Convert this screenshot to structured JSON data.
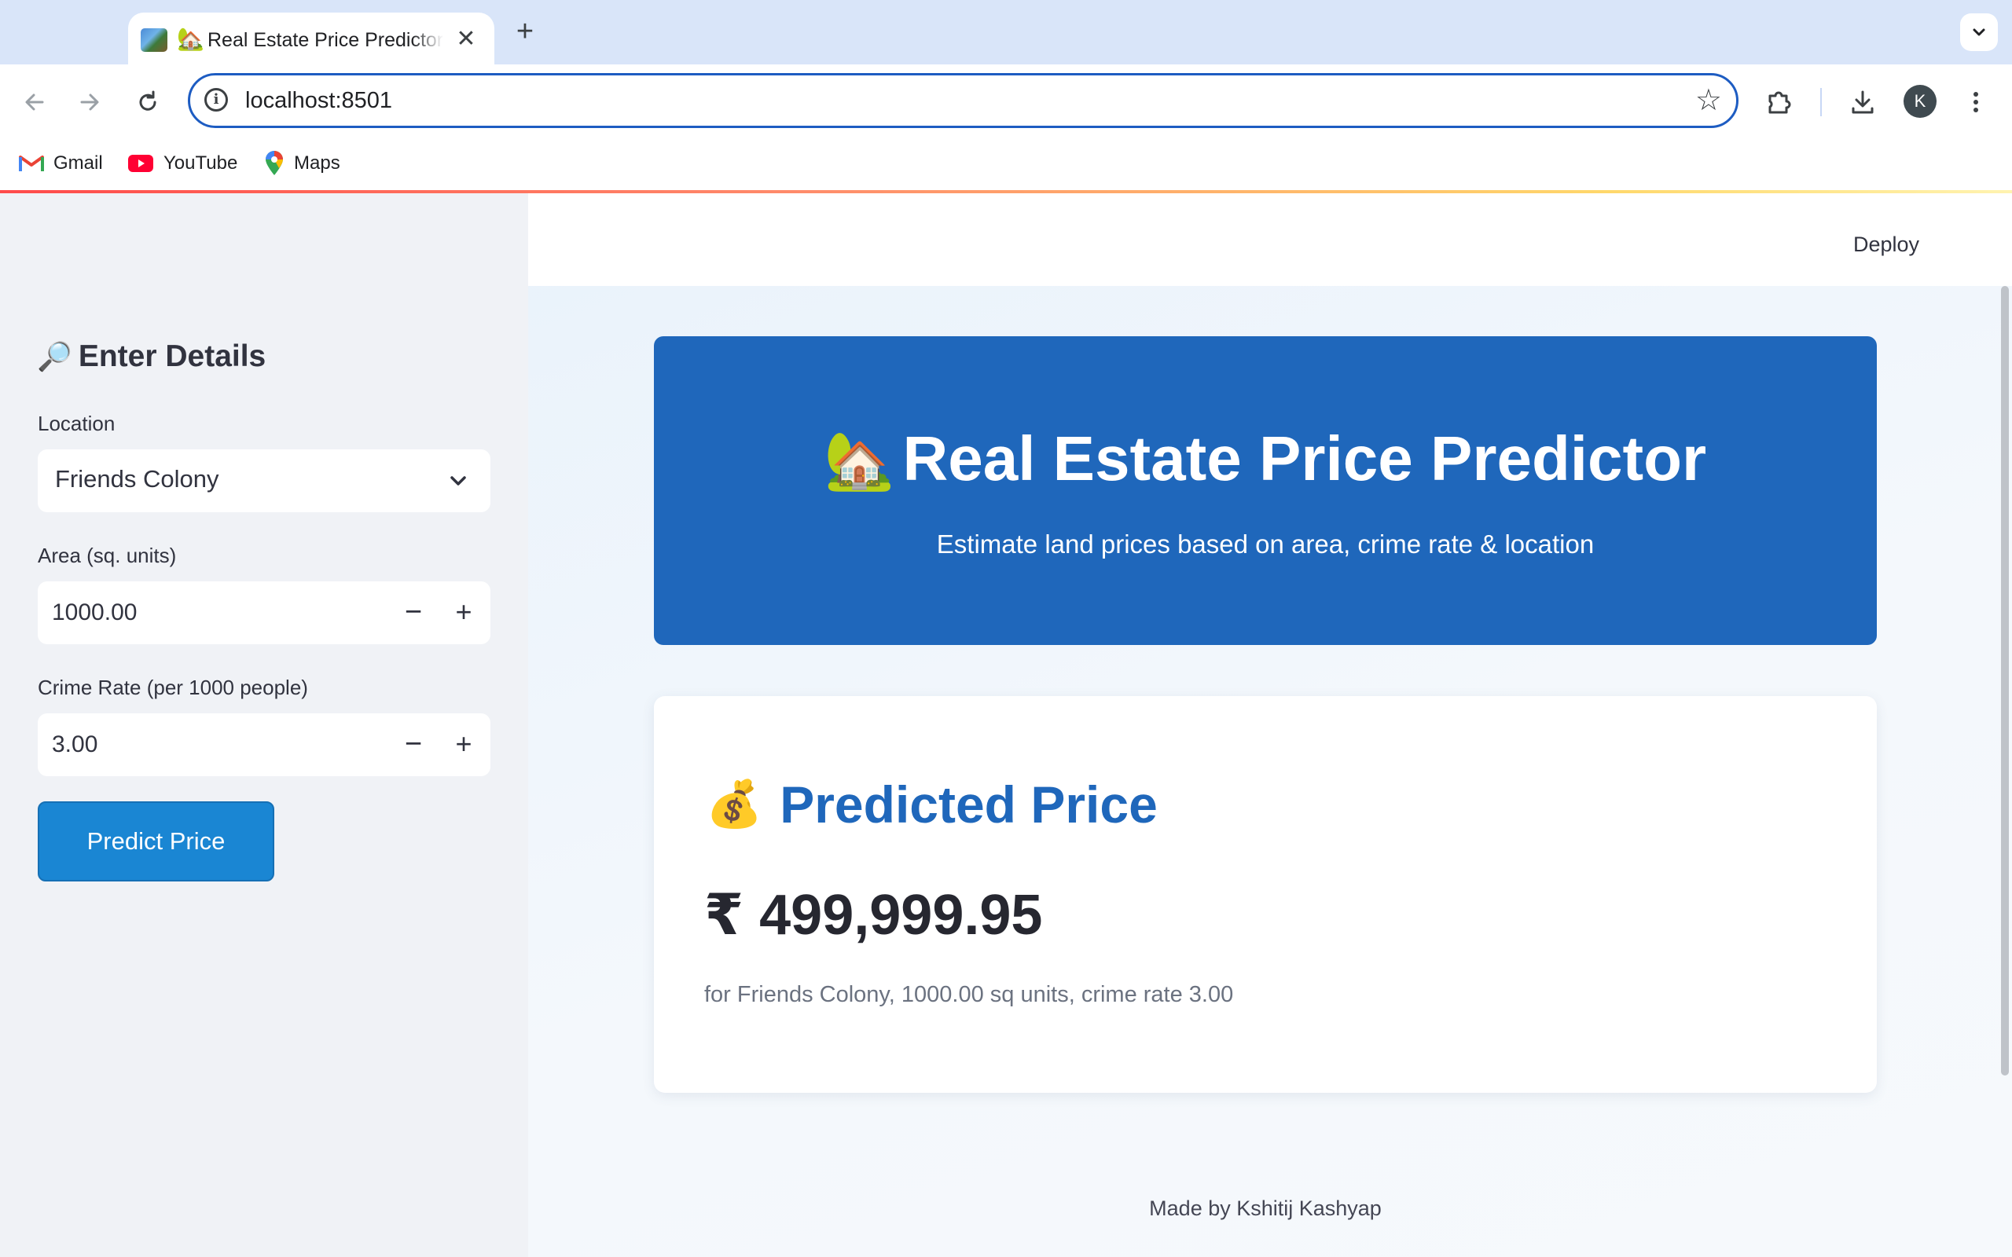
{
  "browser": {
    "tab": {
      "emoji": "🏡",
      "title": "Real Estate Price Predictor",
      "close": "✕"
    },
    "new_tab": "+",
    "url": "localhost:8501",
    "profile_initial": "K",
    "bookmarks": [
      {
        "label": "Gmail",
        "icon": "gmail-icon"
      },
      {
        "label": "YouTube",
        "icon": "youtube-icon"
      },
      {
        "label": "Maps",
        "icon": "maps-icon"
      }
    ]
  },
  "header": {
    "deploy_label": "Deploy"
  },
  "sidebar": {
    "title_emoji": "🔎",
    "title": "Enter Details",
    "location": {
      "label": "Location",
      "value": "Friends Colony"
    },
    "area": {
      "label": "Area (sq. units)",
      "value": "1000.00"
    },
    "crime": {
      "label": "Crime Rate (per 1000 people)",
      "value": "3.00"
    },
    "stepper_minus": "−",
    "stepper_plus": "+",
    "predict_button": "Predict Price"
  },
  "hero": {
    "emoji": "🏡",
    "title": "Real Estate Price Predictor",
    "subtitle": "Estimate land prices based on area, crime rate & location"
  },
  "result": {
    "emoji": "💰",
    "title": "Predicted Price",
    "price": "₹ 499,999.95",
    "details": "for Friends Colony, 1000.00 sq units, crime rate 3.00"
  },
  "footer": {
    "text": "Made by Kshitij Kashyap"
  },
  "colors": {
    "accent": "#1f67bb",
    "button": "#1a86d3",
    "url_focus": "#1d5cc2"
  }
}
